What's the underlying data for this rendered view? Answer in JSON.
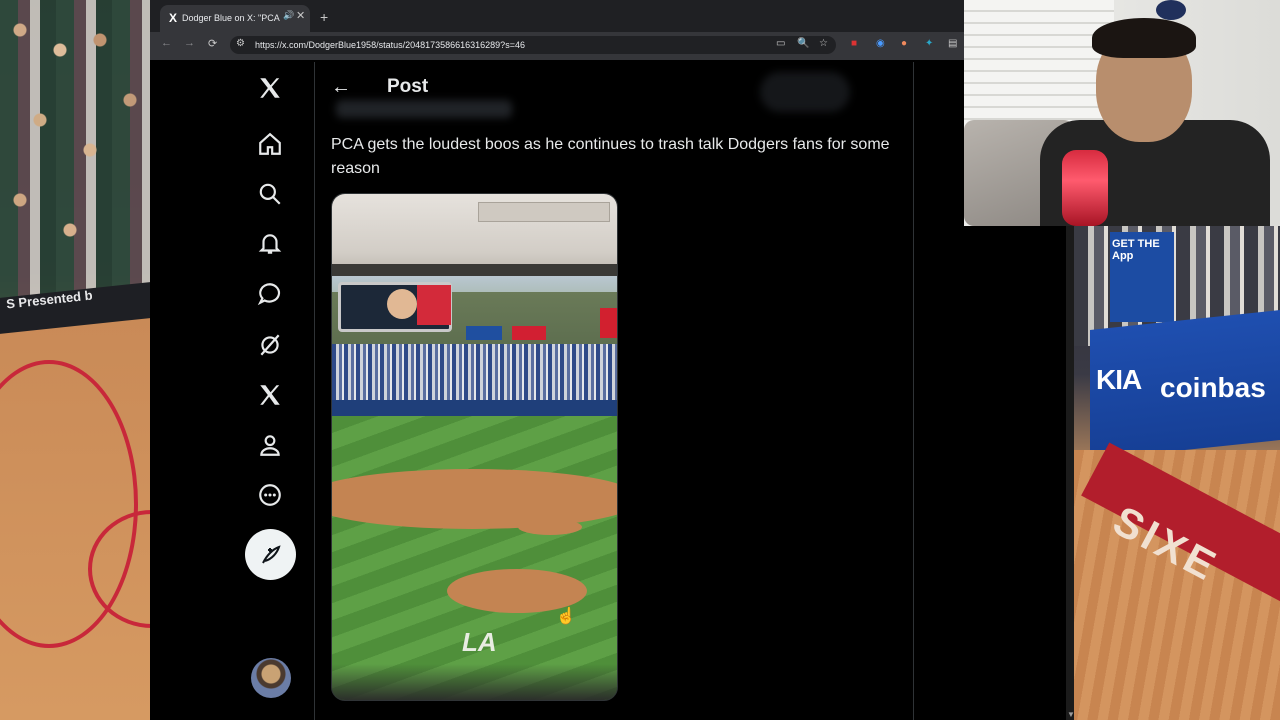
{
  "browser": {
    "tab_title": "Dodger Blue on X: \"PCA ge",
    "tab_favicon": "X",
    "tab_close": "✕",
    "new_tab": "+",
    "url": "https://x.com/DodgerBlue1958/status/2048173586616316289?s=46"
  },
  "x_app": {
    "header_title": "Post",
    "back_icon": "arrow-left-icon",
    "tweet_text": "PCA gets the loudest boos as he continues to trash talk Dodgers fans for some reason",
    "nav_items": [
      "x-logo-icon",
      "home-icon",
      "search-icon",
      "notifications-icon",
      "messages-icon",
      "grok-icon",
      "x-premium-icon",
      "profile-icon",
      "more-icon"
    ],
    "post_button_icon": "compose-icon",
    "video_overlay_text": "LA"
  },
  "overlay": {
    "left_ad_text": "S  Presented b",
    "right_banner_text": "GET THE App",
    "right_sponsor_1": "KIA",
    "right_sponsor_2": "coinbas",
    "right_floor_text": "SIXE"
  },
  "colors": {
    "x_background": "#000000",
    "x_text": "#e7e9ea",
    "x_border": "#2f3336",
    "browser_bg": "#1f2023",
    "court_red": "#b21e2c"
  }
}
